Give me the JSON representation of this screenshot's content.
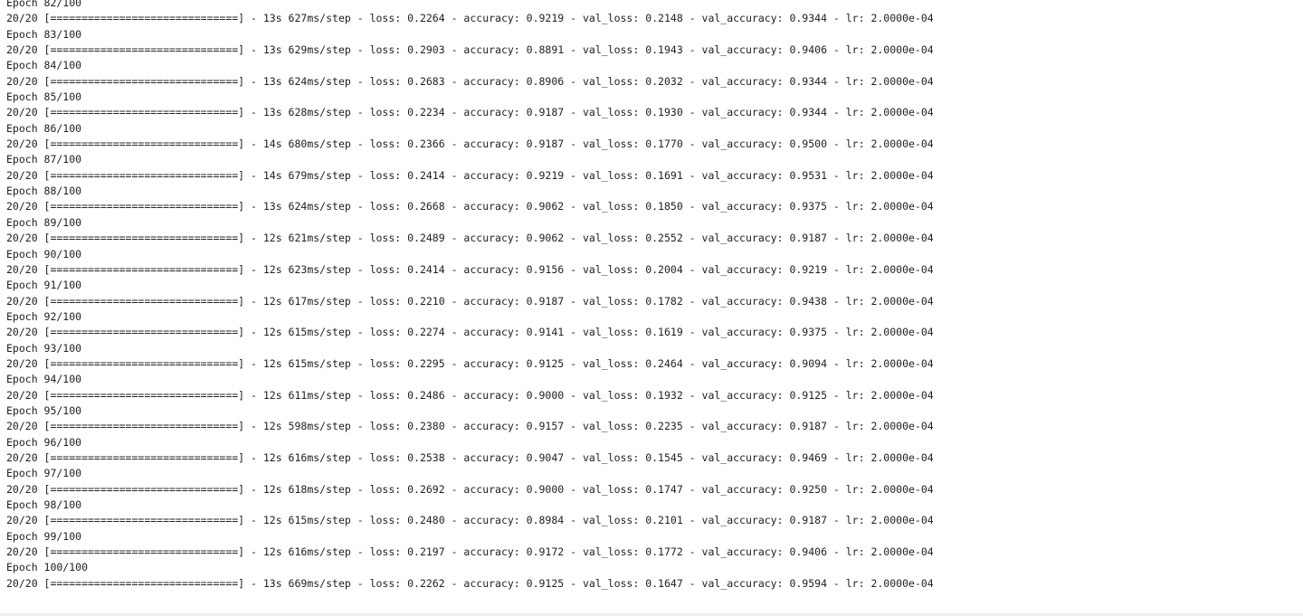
{
  "log": {
    "lines": [
      "Epoch 82/100",
      "20/20 [==============================] - 13s 627ms/step - loss: 0.2264 - accuracy: 0.9219 - val_loss: 0.2148 - val_accuracy: 0.9344 - lr: 2.0000e-04",
      "Epoch 83/100",
      "20/20 [==============================] - 13s 629ms/step - loss: 0.2903 - accuracy: 0.8891 - val_loss: 0.1943 - val_accuracy: 0.9406 - lr: 2.0000e-04",
      "Epoch 84/100",
      "20/20 [==============================] - 13s 624ms/step - loss: 0.2683 - accuracy: 0.8906 - val_loss: 0.2032 - val_accuracy: 0.9344 - lr: 2.0000e-04",
      "Epoch 85/100",
      "20/20 [==============================] - 13s 628ms/step - loss: 0.2234 - accuracy: 0.9187 - val_loss: 0.1930 - val_accuracy: 0.9344 - lr: 2.0000e-04",
      "Epoch 86/100",
      "20/20 [==============================] - 14s 680ms/step - loss: 0.2366 - accuracy: 0.9187 - val_loss: 0.1770 - val_accuracy: 0.9500 - lr: 2.0000e-04",
      "Epoch 87/100",
      "20/20 [==============================] - 14s 679ms/step - loss: 0.2414 - accuracy: 0.9219 - val_loss: 0.1691 - val_accuracy: 0.9531 - lr: 2.0000e-04",
      "Epoch 88/100",
      "20/20 [==============================] - 13s 624ms/step - loss: 0.2668 - accuracy: 0.9062 - val_loss: 0.1850 - val_accuracy: 0.9375 - lr: 2.0000e-04",
      "Epoch 89/100",
      "20/20 [==============================] - 12s 621ms/step - loss: 0.2489 - accuracy: 0.9062 - val_loss: 0.2552 - val_accuracy: 0.9187 - lr: 2.0000e-04",
      "Epoch 90/100",
      "20/20 [==============================] - 12s 623ms/step - loss: 0.2414 - accuracy: 0.9156 - val_loss: 0.2004 - val_accuracy: 0.9219 - lr: 2.0000e-04",
      "Epoch 91/100",
      "20/20 [==============================] - 12s 617ms/step - loss: 0.2210 - accuracy: 0.9187 - val_loss: 0.1782 - val_accuracy: 0.9438 - lr: 2.0000e-04",
      "Epoch 92/100",
      "20/20 [==============================] - 12s 615ms/step - loss: 0.2274 - accuracy: 0.9141 - val_loss: 0.1619 - val_accuracy: 0.9375 - lr: 2.0000e-04",
      "Epoch 93/100",
      "20/20 [==============================] - 12s 615ms/step - loss: 0.2295 - accuracy: 0.9125 - val_loss: 0.2464 - val_accuracy: 0.9094 - lr: 2.0000e-04",
      "Epoch 94/100",
      "20/20 [==============================] - 12s 611ms/step - loss: 0.2486 - accuracy: 0.9000 - val_loss: 0.1932 - val_accuracy: 0.9125 - lr: 2.0000e-04",
      "Epoch 95/100",
      "20/20 [==============================] - 12s 598ms/step - loss: 0.2380 - accuracy: 0.9157 - val_loss: 0.2235 - val_accuracy: 0.9187 - lr: 2.0000e-04",
      "Epoch 96/100",
      "20/20 [==============================] - 12s 616ms/step - loss: 0.2538 - accuracy: 0.9047 - val_loss: 0.1545 - val_accuracy: 0.9469 - lr: 2.0000e-04",
      "Epoch 97/100",
      "20/20 [==============================] - 12s 618ms/step - loss: 0.2692 - accuracy: 0.9000 - val_loss: 0.1747 - val_accuracy: 0.9250 - lr: 2.0000e-04",
      "Epoch 98/100",
      "20/20 [==============================] - 12s 615ms/step - loss: 0.2480 - accuracy: 0.8984 - val_loss: 0.2101 - val_accuracy: 0.9187 - lr: 2.0000e-04",
      "Epoch 99/100",
      "20/20 [==============================] - 12s 616ms/step - loss: 0.2197 - accuracy: 0.9172 - val_loss: 0.1772 - val_accuracy: 0.9406 - lr: 2.0000e-04",
      "Epoch 100/100",
      "20/20 [==============================] - 13s 669ms/step - loss: 0.2262 - accuracy: 0.9125 - val_loss: 0.1647 - val_accuracy: 0.9594 - lr: 2.0000e-04"
    ]
  },
  "colors": {
    "text": "#212121",
    "background": "#ffffff",
    "divider": "#eeeeee"
  }
}
